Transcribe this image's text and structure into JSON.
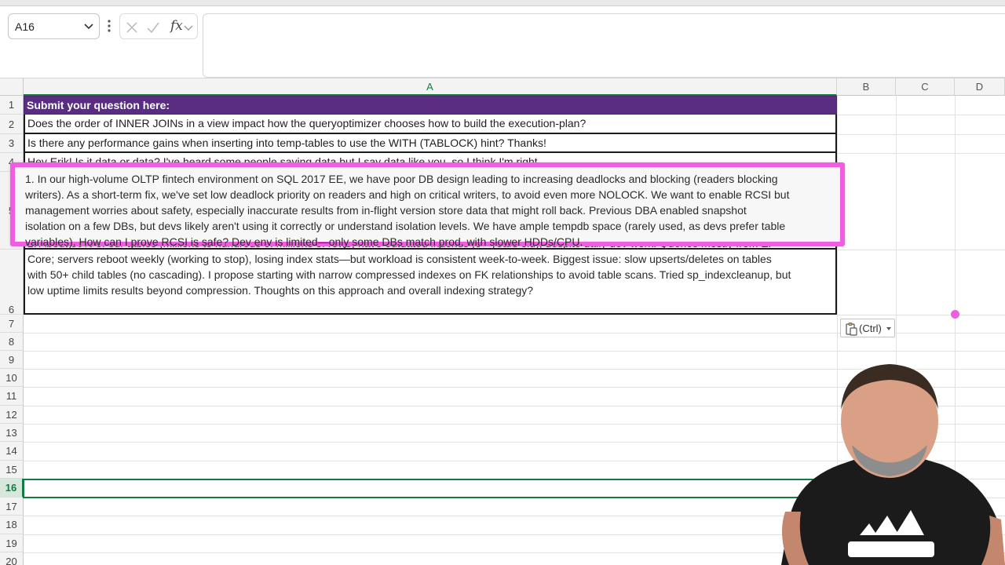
{
  "name_box": {
    "value": "A16"
  },
  "formula_bar": {
    "fx_label": "fx",
    "value": ""
  },
  "columns": [
    "A",
    "B",
    "C",
    "D"
  ],
  "rows": {
    "row1": {
      "num": "1",
      "text": "Submit your question here:"
    },
    "row2": {
      "num": "2",
      "text": "Does the order of INNER JOINs in a view impact how the queryoptimizer chooses how to build the execution-plan?"
    },
    "row3": {
      "num": "3",
      "text": "Is there any performance gains when inserting into temp-tables to use the WITH (TABLOCK) hint? Thanks!"
    },
    "row4": {
      "num": "4",
      "text": "Hey Erik! Is it data or data? I've heard some people saying data but I say data like you, so I think I'm right."
    },
    "row5": {
      "num": "5",
      "lines": [
        "1. In our high-volume OLTP fintech environment on SQL 2017 EE, we have poor DB design leading to increasing deadlocks and blocking (readers blocking",
        "writers). As a short-term fix, we've set low deadlock priority on readers and high on critical writers, to avoid even more NOLOCK. We want to enable RCSI but",
        "management worries about safety, especially inaccurate results from in-flight version store data that might roll back. Previous DBA enabled snapshot",
        "isolation on a few DBs, but devs likely aren't using it correctly or understand isolation levels. We have ample tempdb space (rarely used, as devs prefer table",
        "variables). How can I prove RCSI is safe? Dev env is limited—only some DBs match prod, with slower HDDs/CPU."
      ]
    },
    "row6": {
      "num": "6",
      "lines": [
        "2. About 80% of our tables (millions to hundreds of millions of rows) have outdated indexes (5+ years old), despite daily dev work. Queries mostly from EF",
        "Core; servers reboot weekly (working to stop), losing index stats—but workload is consistent week-to-week. Biggest issue: slow upserts/deletes on tables",
        "with 50+ child tables (no cascading). I propose starting with narrow compressed indexes on FK relationships to avoid table scans. Tried sp_indexcleanup, but",
        "low uptime limits results beyond compression. Thoughts on this approach and overall indexing strategy?"
      ]
    }
  },
  "empty_rows": [
    "7",
    "8",
    "9",
    "10",
    "11",
    "12",
    "13",
    "14",
    "15",
    "16",
    "17",
    "18",
    "19",
    "20"
  ],
  "paste_options": {
    "label": "(Ctrl)"
  },
  "colors": {
    "header_purple": "#5b2d82",
    "highlight_magenta": "#f15ce3",
    "selection_green": "#107c41"
  }
}
